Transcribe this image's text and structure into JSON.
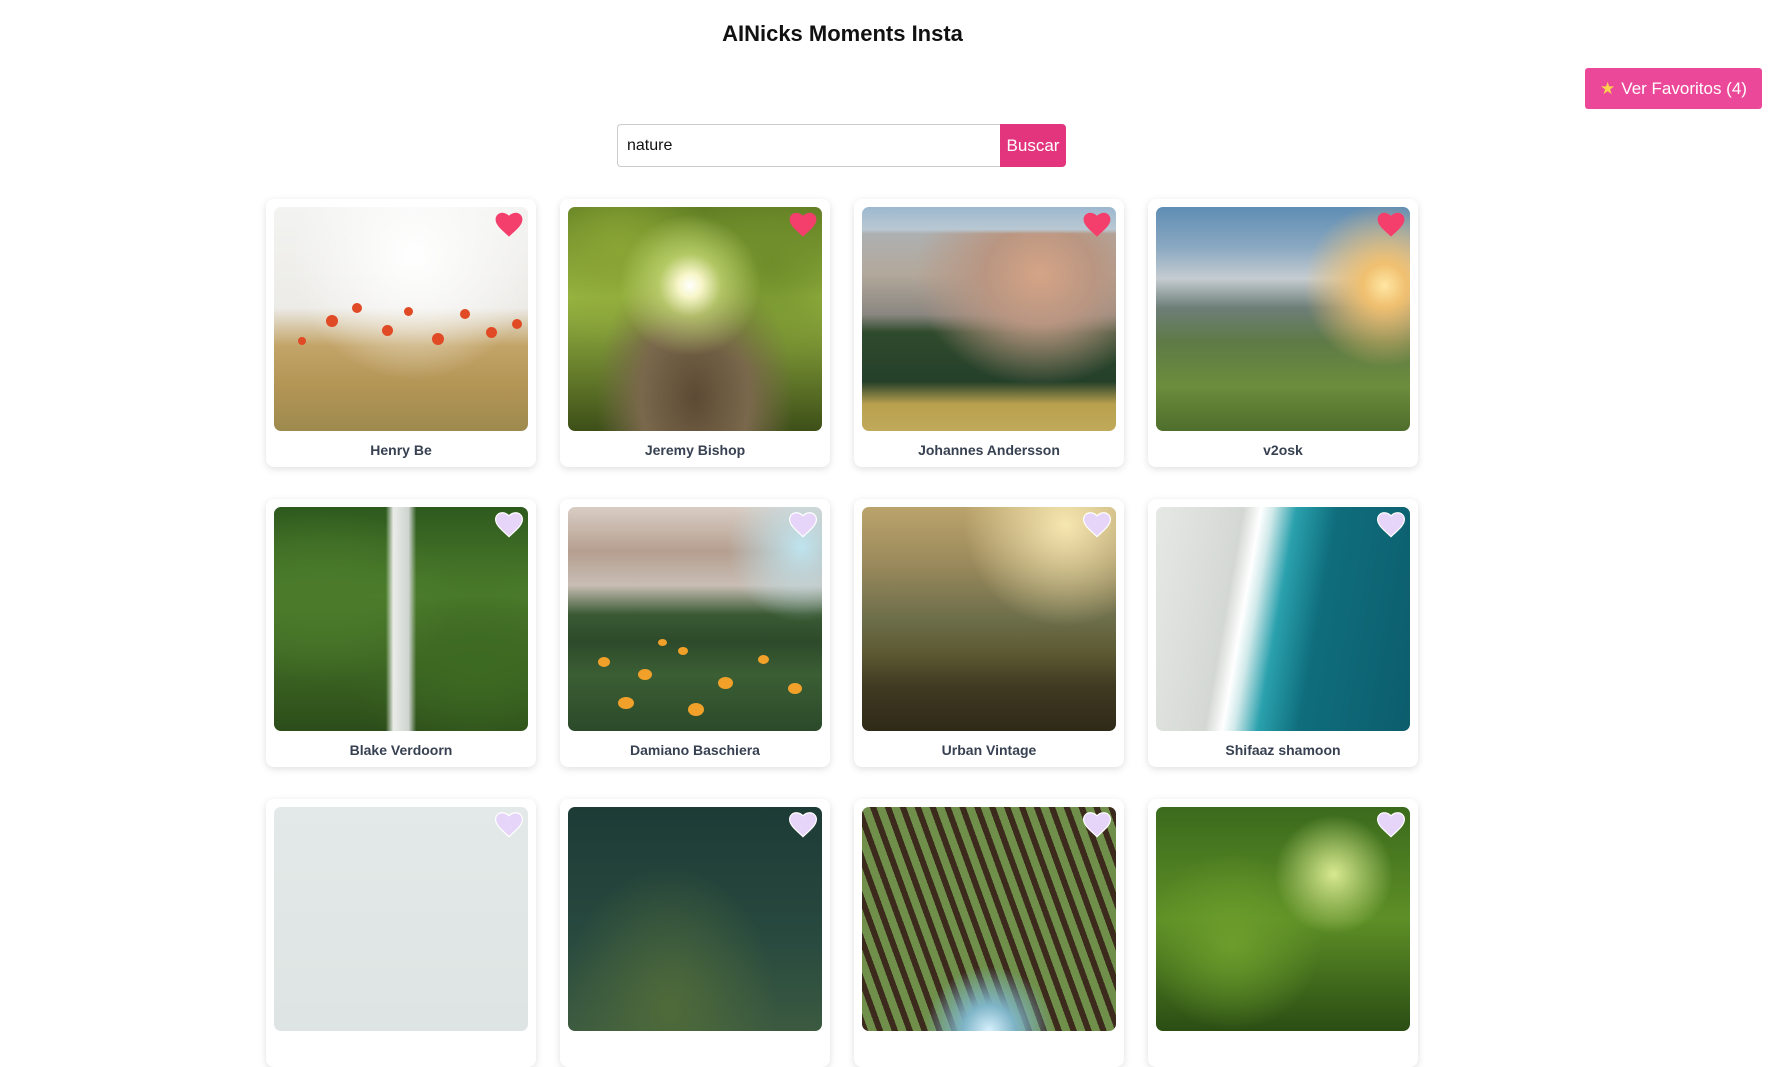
{
  "header": {
    "title": "AINicks Moments Insta"
  },
  "favorites_button": {
    "icon": "star-icon",
    "label": "Ver Favoritos (4)"
  },
  "search": {
    "value": "nature",
    "button_label": "Buscar"
  },
  "colors": {
    "accent": "#ec4899",
    "search_button": "#e2357e",
    "heart_filled": "#f43f6c",
    "heart_empty": "#e6d5f8"
  },
  "photos": [
    {
      "author": "Henry Be",
      "favorite": true
    },
    {
      "author": "Jeremy Bishop",
      "favorite": true
    },
    {
      "author": "Johannes Andersson",
      "favorite": true
    },
    {
      "author": "v2osk",
      "favorite": true
    },
    {
      "author": "Blake Verdoorn",
      "favorite": false
    },
    {
      "author": "Damiano Baschiera",
      "favorite": false
    },
    {
      "author": "Urban Vintage",
      "favorite": false
    },
    {
      "author": "Shifaaz shamoon",
      "favorite": false
    },
    {
      "author": "",
      "favorite": false
    },
    {
      "author": "",
      "favorite": false
    },
    {
      "author": "",
      "favorite": false
    },
    {
      "author": "",
      "favorite": false
    }
  ]
}
